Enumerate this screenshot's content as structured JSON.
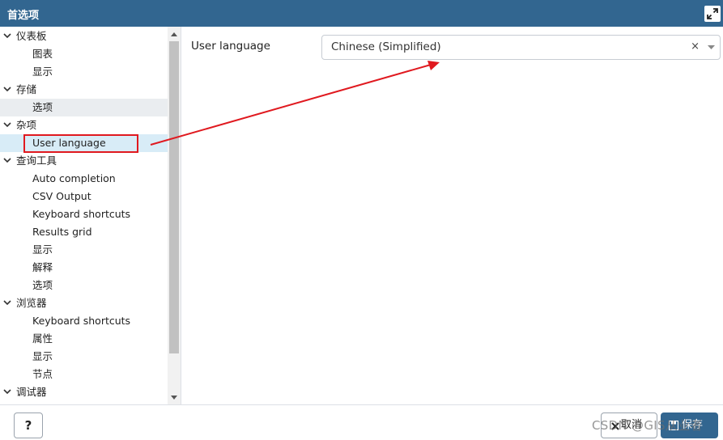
{
  "dialog": {
    "title": "首选项"
  },
  "tree": [
    {
      "label": "仪表板",
      "level": "parent"
    },
    {
      "label": "图表",
      "level": "child"
    },
    {
      "label": "显示",
      "level": "child"
    },
    {
      "label": "存储",
      "level": "parent"
    },
    {
      "label": "选项",
      "level": "child",
      "state": "selected-gray"
    },
    {
      "label": "杂项",
      "level": "parent"
    },
    {
      "label": "User language",
      "level": "child",
      "state": "selected"
    },
    {
      "label": "查询工具",
      "level": "parent"
    },
    {
      "label": "Auto completion",
      "level": "child"
    },
    {
      "label": "CSV Output",
      "level": "child"
    },
    {
      "label": "Keyboard shortcuts",
      "level": "child"
    },
    {
      "label": "Results grid",
      "level": "child"
    },
    {
      "label": "显示",
      "level": "child"
    },
    {
      "label": "解释",
      "level": "child"
    },
    {
      "label": "选项",
      "level": "child"
    },
    {
      "label": "浏览器",
      "level": "parent"
    },
    {
      "label": "Keyboard shortcuts",
      "level": "child"
    },
    {
      "label": "属性",
      "level": "child"
    },
    {
      "label": "显示",
      "level": "child"
    },
    {
      "label": "节点",
      "level": "child"
    },
    {
      "label": "调试器",
      "level": "parent"
    }
  ],
  "form": {
    "language_label": "User language",
    "language_value": "Chinese (Simplified)",
    "clear_glyph": "×"
  },
  "footer": {
    "help_label": "?",
    "cancel_label": "取消",
    "save_label": "保存"
  },
  "watermark": "CSDN @GIS从业者",
  "colors": {
    "title_bar": "#326690",
    "primary_button": "#326690",
    "annotation_red": "#e0191f",
    "selected_row": "#d8ecf7",
    "selected_row_gray": "#eaedf0"
  }
}
